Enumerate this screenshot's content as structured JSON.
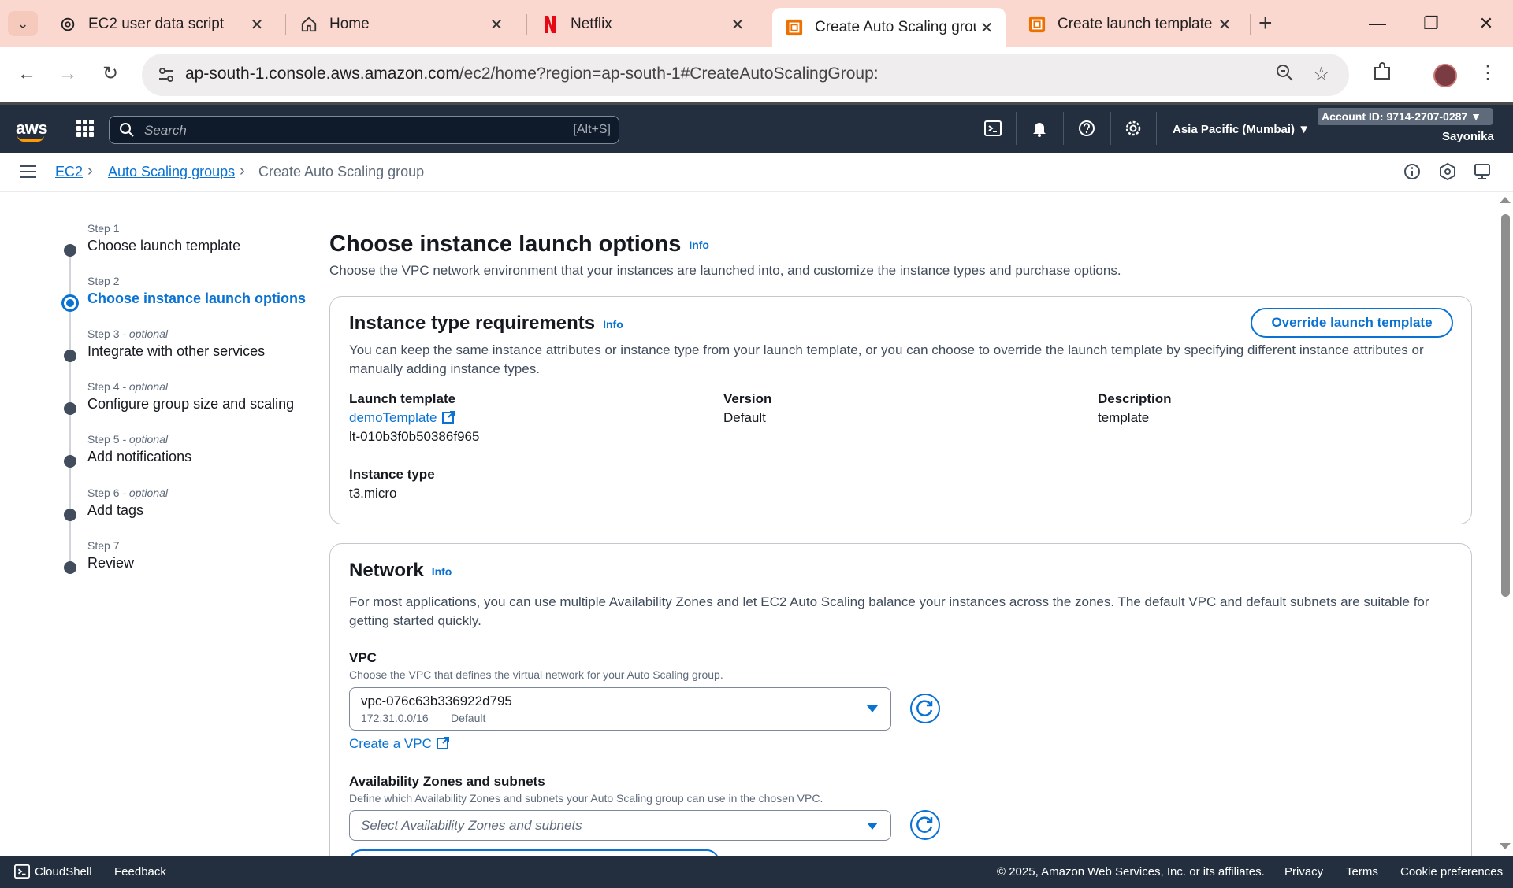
{
  "browser": {
    "tabs": [
      {
        "label": "EC2 user data script",
        "icon": "openai-icon"
      },
      {
        "label": "Home",
        "icon": "home-icon"
      },
      {
        "label": "Netflix",
        "icon": "netflix-icon"
      },
      {
        "label": "Create Auto Scaling grou",
        "icon": "aws-ec2-icon",
        "active": true
      },
      {
        "label": "Create launch template |",
        "icon": "aws-ec2-icon"
      }
    ],
    "close_glyph": "✕",
    "new_tab_glyph": "+",
    "url_host": "ap-south-1.console.aws.amazon.com",
    "url_path": "/ec2/home?region=ap-south-1#CreateAutoScalingGroup:"
  },
  "aws_header": {
    "logo_text": "aws",
    "search_placeholder": "Search",
    "search_shortcut": "[Alt+S]",
    "region": "Asia Pacific (Mumbai) ▼",
    "account": "Account ID: 9714-2707-0287 ▼",
    "user": "Sayonika"
  },
  "breadcrumb": {
    "items": [
      "EC2",
      "Auto Scaling groups",
      "Create Auto Scaling group"
    ]
  },
  "steps": [
    {
      "num": "Step 1",
      "optional": "",
      "name": "Choose launch template"
    },
    {
      "num": "Step 2",
      "optional": "",
      "name": "Choose instance launch options"
    },
    {
      "num": "Step 3",
      "optional": " - optional",
      "name": "Integrate with other services"
    },
    {
      "num": "Step 4",
      "optional": " - optional",
      "name": "Configure group size and scaling"
    },
    {
      "num": "Step 5",
      "optional": " - optional",
      "name": "Add notifications"
    },
    {
      "num": "Step 6",
      "optional": " - optional",
      "name": "Add tags"
    },
    {
      "num": "Step 7",
      "optional": "",
      "name": "Review"
    }
  ],
  "page": {
    "title": "Choose instance launch options",
    "info": "Info",
    "description": "Choose the VPC network environment that your instances are launched into, and customize the instance types and purchase options."
  },
  "instance_card": {
    "title": "Instance type requirements",
    "info": "Info",
    "override_button": "Override launch template",
    "description": "You can keep the same instance attributes or instance type from your launch template, or you can choose to override the launch template by specifying different instance attributes or manually adding instance types.",
    "launch_template_label": "Launch template",
    "launch_template_name": "demoTemplate",
    "launch_template_id": "lt-010b3f0b50386f965",
    "version_label": "Version",
    "version_value": "Default",
    "description_label": "Description",
    "description_value": "template",
    "instance_type_label": "Instance type",
    "instance_type_value": "t3.micro"
  },
  "network_card": {
    "title": "Network",
    "info": "Info",
    "description": "For most applications, you can use multiple Availability Zones and let EC2 Auto Scaling balance your instances across the zones. The default VPC and default subnets are suitable for getting started quickly.",
    "vpc_label": "VPC",
    "vpc_desc": "Choose the VPC that defines the virtual network for your Auto Scaling group.",
    "vpc_value": "vpc-076c63b336922d795",
    "vpc_cidr": "172.31.0.0/16",
    "vpc_tag": "Default",
    "create_vpc": "Create a VPC",
    "az_label": "Availability Zones and subnets",
    "az_desc": "Define which Availability Zones and subnets your Auto Scaling group can use in the chosen VPC.",
    "az_placeholder": "Select Availability Zones and subnets"
  },
  "footer": {
    "cloudshell": "CloudShell",
    "feedback": "Feedback",
    "copyright": "© 2025, Amazon Web Services, Inc. or its affiliates.",
    "privacy": "Privacy",
    "terms": "Terms",
    "cookies": "Cookie preferences"
  }
}
